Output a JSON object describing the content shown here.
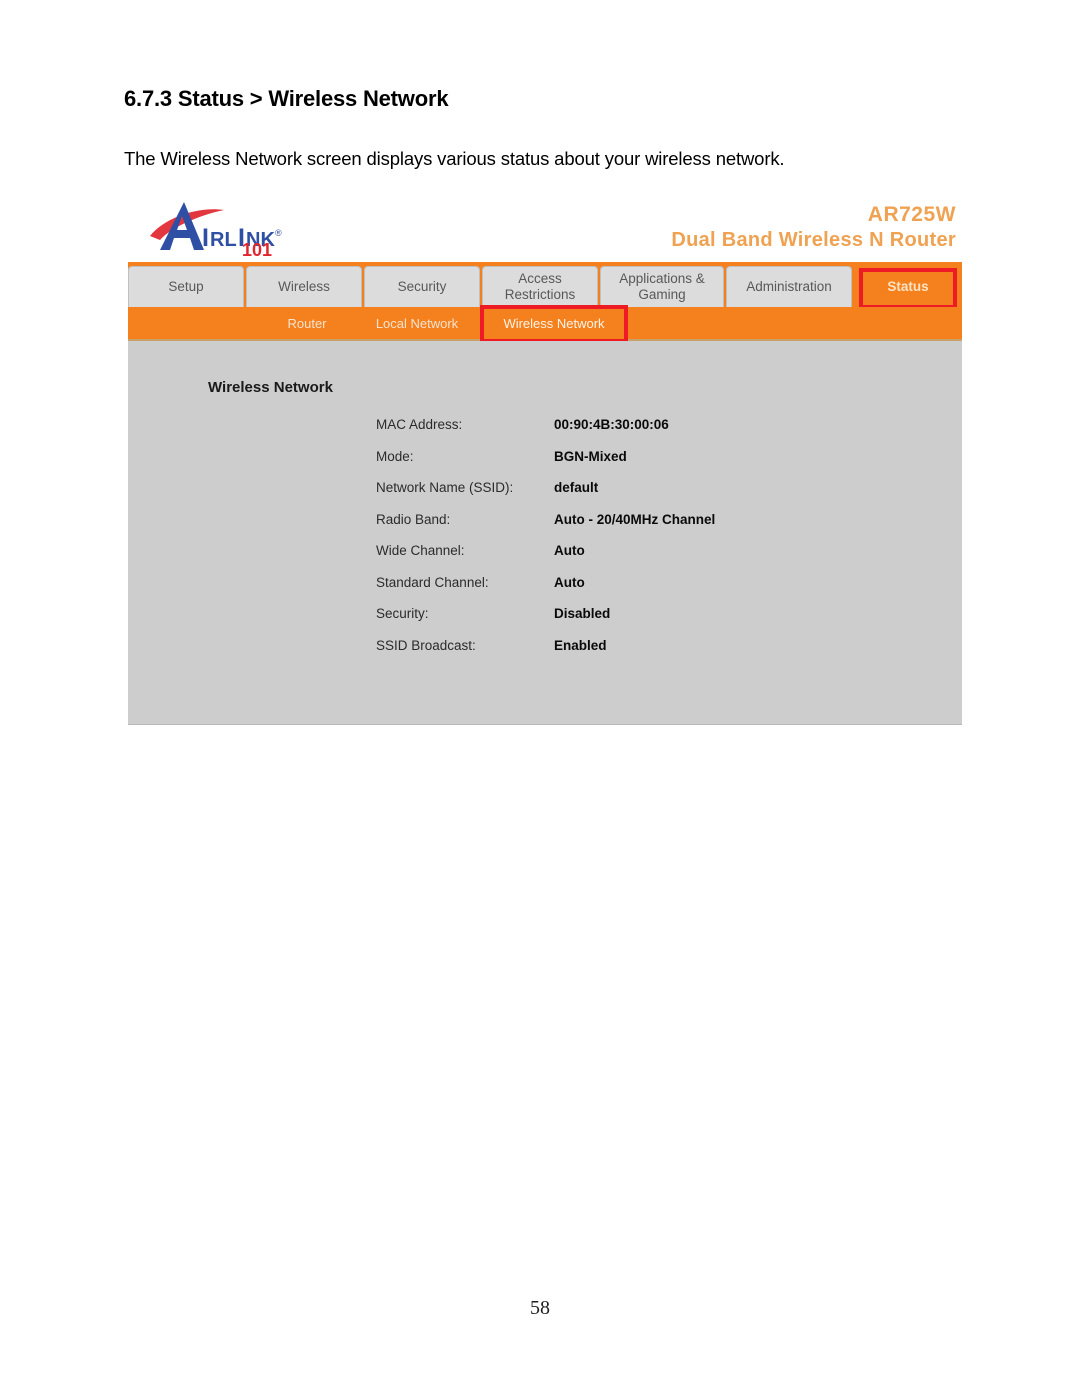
{
  "document": {
    "heading": "6.7.3 Status > Wireless Network",
    "paragraph": "The Wireless Network screen displays various status about your wireless network.",
    "page_number": "58"
  },
  "router_ui": {
    "brand": {
      "logo_name": "AIRLINK",
      "logo_suffix": "101",
      "registered_mark": "®",
      "brand_blue": "#2E4FA3",
      "brand_red": "#E0262E"
    },
    "model": {
      "name": "AR725W",
      "description": "Dual Band Wireless N Router",
      "color": "#EFA251"
    },
    "theme": {
      "orange": "#F5801E",
      "panel_gray": "#CDCDCD",
      "tab_gray": "#DCDCDC",
      "highlight_red": "#ED1C24"
    },
    "tabs": [
      {
        "label": "Setup",
        "active": false
      },
      {
        "label": "Wireless",
        "active": false
      },
      {
        "label": "Security",
        "active": false
      },
      {
        "label": "Access Restrictions",
        "active": false
      },
      {
        "label": "Applications & Gaming",
        "active": false
      },
      {
        "label": "Administration",
        "active": false
      },
      {
        "label": "Status",
        "active": true
      }
    ],
    "tab_labels": {
      "setup": "Setup",
      "wireless": "Wireless",
      "security": "Security",
      "access_restrictions_line1": "Access",
      "access_restrictions_line2": "Restrictions",
      "applications_line1": "Applications &",
      "applications_line2": "Gaming",
      "administration": "Administration",
      "status": "Status"
    },
    "subtabs": [
      {
        "label": "Router",
        "active": false
      },
      {
        "label": "Local Network",
        "active": false
      },
      {
        "label": "Wireless Network",
        "active": true
      }
    ],
    "subtab_labels": {
      "router": "Router",
      "local_network": "Local Network",
      "wireless_network": "Wireless Network"
    },
    "panel": {
      "title": "Wireless Network",
      "fields": [
        {
          "label": "MAC Address:",
          "value": "00:90:4B:30:00:06"
        },
        {
          "label": "Mode:",
          "value": "BGN-Mixed"
        },
        {
          "label": "Network Name (SSID):",
          "value": "default"
        },
        {
          "label": "Radio Band:",
          "value": "Auto - 20/40MHz Channel"
        },
        {
          "label": "Wide Channel:",
          "value": "Auto"
        },
        {
          "label": "Standard Channel:",
          "value": "Auto"
        },
        {
          "label": "Security:",
          "value": "Disabled"
        },
        {
          "label": "SSID Broadcast:",
          "value": "Enabled"
        }
      ],
      "field_labels": {
        "mac_address": "MAC Address:",
        "mode": "Mode:",
        "ssid": "Network Name (SSID):",
        "radio_band": "Radio Band:",
        "wide_channel": "Wide Channel:",
        "standard_channel": "Standard Channel:",
        "security": "Security:",
        "ssid_broadcast": "SSID Broadcast:"
      },
      "field_values": {
        "mac_address": "00:90:4B:30:00:06",
        "mode": "BGN-Mixed",
        "ssid": "default",
        "radio_band": "Auto - 20/40MHz Channel",
        "wide_channel": "Auto",
        "standard_channel": "Auto",
        "security": "Disabled",
        "ssid_broadcast": "Enabled"
      }
    }
  }
}
